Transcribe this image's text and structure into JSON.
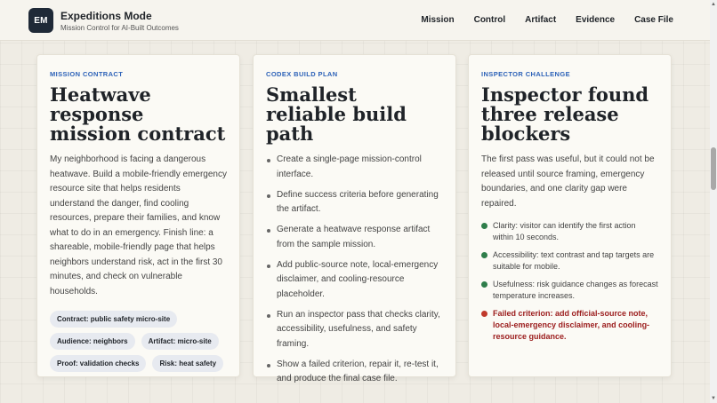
{
  "header": {
    "logo_initials": "EM",
    "title": "Expeditions Mode",
    "subtitle": "Mission Control for AI-Built Outcomes",
    "nav": [
      {
        "label": "Mission"
      },
      {
        "label": "Control"
      },
      {
        "label": "Artifact"
      },
      {
        "label": "Evidence"
      },
      {
        "label": "Case File"
      }
    ]
  },
  "cards": {
    "contract": {
      "label": "MISSION CONTRACT",
      "title": "Heatwave response mission contract",
      "body": "My neighborhood is facing a dangerous heatwave. Build a mobile-friendly emergency resource site that helps residents understand the danger, find cooling resources, prepare their families, and know what to do in an emergency. Finish line: a shareable, mobile-friendly page that helps neighbors understand risk, act in the first 30 minutes, and check on vulnerable households.",
      "pills": [
        "Contract: public safety micro-site",
        "Audience: neighbors",
        "Artifact: micro-site",
        "Proof: validation checks",
        "Risk: heat safety"
      ]
    },
    "plan": {
      "label": "CODEX BUILD PLAN",
      "title": "Smallest reliable build path",
      "steps": [
        "Create a single-page mission-control interface.",
        "Define success criteria before generating the artifact.",
        "Generate a heatwave response artifact from the sample mission.",
        "Add public-source note, local-emergency disclaimer, and cooling-resource placeholder.",
        "Run an inspector pass that checks clarity, accessibility, usefulness, and safety framing.",
        "Show a failed criterion, repair it, re-test it, and produce the final case file."
      ]
    },
    "inspector": {
      "label": "INSPECTOR CHALLENGE",
      "title": "Inspector found three release blockers",
      "body": "The first pass was useful, but it could not be released until source framing, emergency boundaries, and one clarity gap were repaired.",
      "criteria": [
        {
          "text": "Clarity: visitor can identify the first action within 10 seconds.",
          "status": "pass",
          "color": "#2e7d4a"
        },
        {
          "text": "Accessibility: text contrast and tap targets are suitable for mobile.",
          "status": "pass",
          "color": "#2e7d4a"
        },
        {
          "text": "Usefulness: risk guidance changes as forecast temperature increases.",
          "status": "pass",
          "color": "#2e7d4a"
        },
        {
          "text": "Failed criterion: add official-source note, local-emergency disclaimer, and cooling-resource guidance.",
          "status": "fail",
          "color": "#c0392b"
        }
      ]
    }
  },
  "colors": {
    "accent_label": "#2d62b8",
    "logo_bg": "#1f2937",
    "pill_bg": "#e7eaf0",
    "fail_text": "#9b1c1c"
  }
}
